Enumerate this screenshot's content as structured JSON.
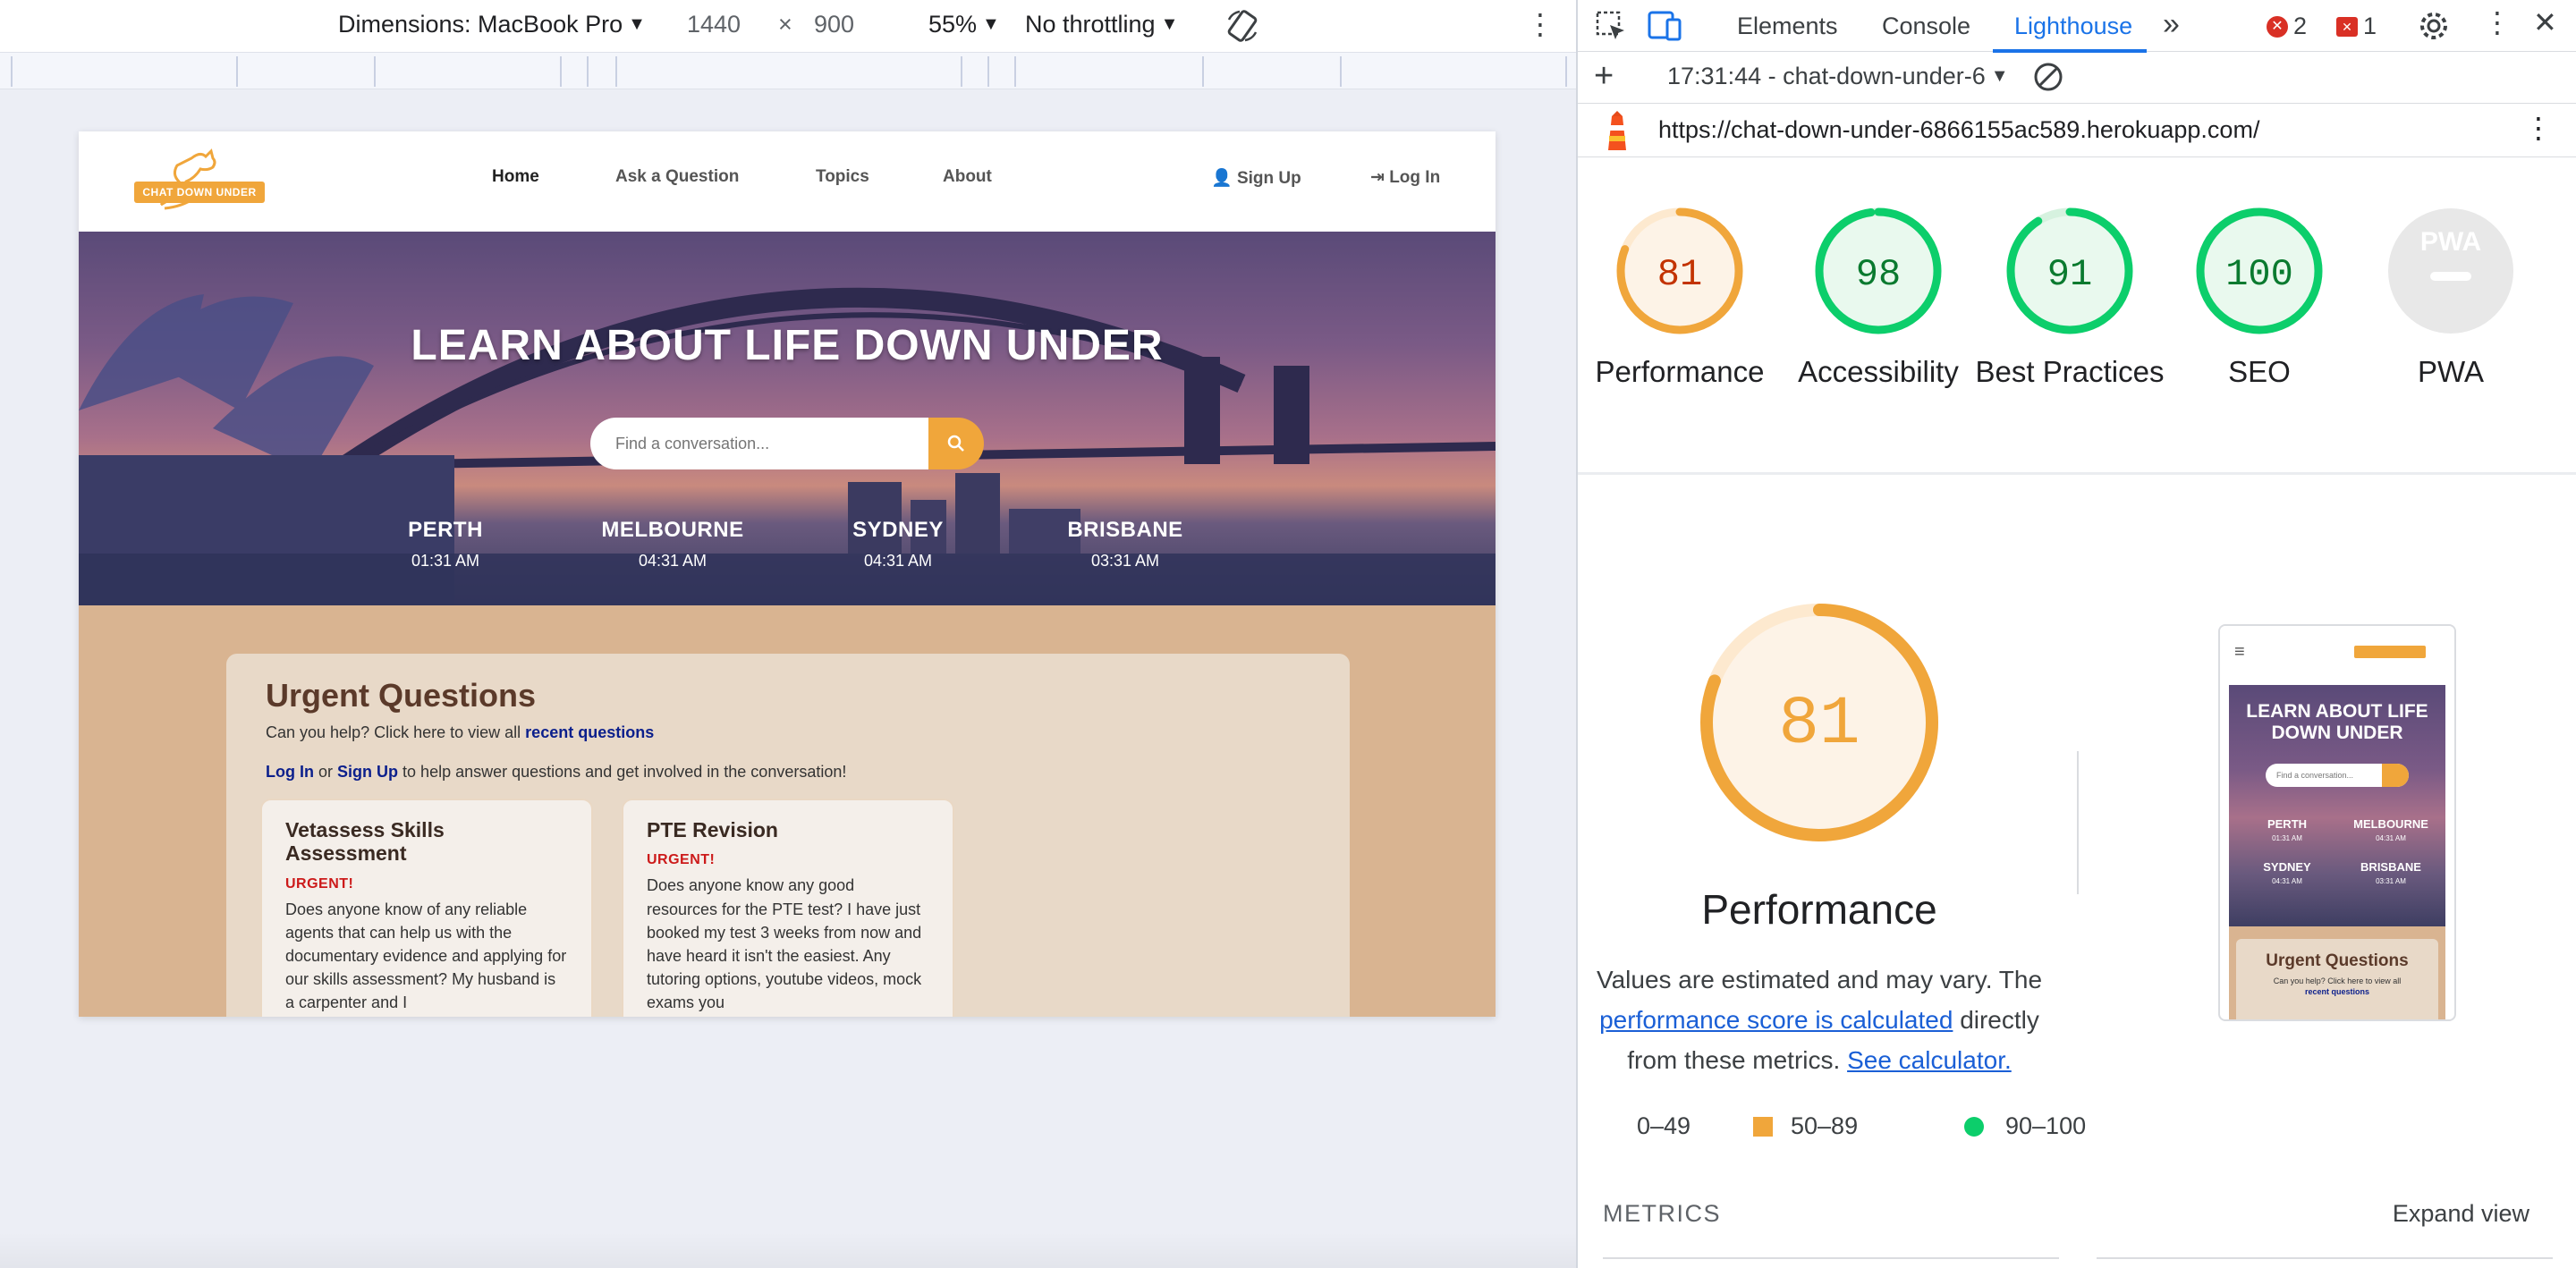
{
  "device_toolbar": {
    "dimensions_label": "Dimensions: MacBook Pro",
    "width": "1440",
    "times": "×",
    "height": "900",
    "zoom": "55%",
    "throttling": "No throttling"
  },
  "site": {
    "logo_text": "CHAT DOWN UNDER",
    "nav": {
      "home": "Home",
      "ask": "Ask a Question",
      "topics": "Topics",
      "about": "About",
      "signup": "Sign Up",
      "login": "Log In"
    },
    "hero": {
      "title": "LEARN ABOUT LIFE DOWN UNDER",
      "search_placeholder": "Find a conversation...",
      "cities": [
        {
          "name": "PERTH",
          "time": "01:31 AM"
        },
        {
          "name": "MELBOURNE",
          "time": "04:31 AM"
        },
        {
          "name": "SYDNEY",
          "time": "04:31 AM"
        },
        {
          "name": "BRISBANE",
          "time": "03:31 AM"
        }
      ]
    },
    "urgent": {
      "title": "Urgent Questions",
      "sub_text": "Can you help? Click here to view all",
      "recent_link": "recent questions",
      "login_link": "Log In",
      "or_text": "or",
      "signup_link": "Sign Up",
      "help_text": "to help answer questions and get involved in the conversation!",
      "cards": [
        {
          "title": "Vetassess Skills Assessment",
          "tag": "URGENT!",
          "body": "Does anyone know of any reliable agents that can help us with the documentary evidence and applying for our skills assessment? My husband is a carpenter and I"
        },
        {
          "title": "PTE Revision",
          "tag": "URGENT!",
          "body": "Does anyone know any good resources for the PTE test? I have just booked my test 3 weeks from now and have heard it isn't the easiest. Any tutoring options, youtube videos, mock exams you"
        }
      ]
    }
  },
  "devtools": {
    "tabs": {
      "elements": "Elements",
      "console": "Console",
      "lighthouse": "Lighthouse",
      "more": "»"
    },
    "errors_count": "2",
    "issues_count": "1",
    "report_label": "17:31:44 - chat-down-under-6",
    "url": "https://chat-down-under-6866155ac589.herokuapp.com/",
    "scores": [
      {
        "label": "Performance",
        "value": "81",
        "score": 81,
        "category": "average"
      },
      {
        "label": "Accessibility",
        "value": "98",
        "score": 98,
        "category": "pass"
      },
      {
        "label": "Best Practices",
        "value": "91",
        "score": 91,
        "category": "pass"
      },
      {
        "label": "SEO",
        "value": "100",
        "score": 100,
        "category": "pass"
      },
      {
        "label": "PWA",
        "value": "PWA",
        "score": null,
        "category": "na"
      }
    ],
    "performance_big": {
      "value": "81",
      "score": 81,
      "label": "Performance",
      "note_prefix": "Values are estimated and may vary. The",
      "note_link": "performance score is calculated",
      "note_middle": "directly from these metrics.",
      "note_calc": "See calculator."
    },
    "preview": {
      "title": "LEARN ABOUT LIFE DOWN UNDER",
      "search_placeholder": "Find a conversation...",
      "cities": [
        {
          "name": "PERTH",
          "time": "01:31 AM"
        },
        {
          "name": "MELBOURNE",
          "time": "04:31 AM"
        },
        {
          "name": "SYDNEY",
          "time": "04:31 AM"
        },
        {
          "name": "BRISBANE",
          "time": "03:31 AM"
        }
      ],
      "urgent_title": "Urgent Questions",
      "urgent_sub": "Can you help? Click here to view all",
      "recent_link": "recent questions"
    },
    "legend": {
      "fail": "0–49",
      "average": "50–89",
      "pass": "90–100"
    },
    "metrics_title": "METRICS",
    "expand_view": "Expand view"
  },
  "colors": {
    "accent_orange": "#f0a63b",
    "score_fail": "#cc0000",
    "score_average": "#f0a63b",
    "score_pass": "#0cce6b",
    "devtools_blue": "#1a73e8",
    "site_link_navy": "#0b1f8c"
  },
  "icons": {
    "inspect": "inspect-element-icon",
    "device": "device-toggle-icon",
    "rotate": "rotate-icon",
    "gear": "gear-icon",
    "lighthouse": "lighthouse-icon",
    "block": "block-icon",
    "more": "kebab-menu-icon"
  }
}
